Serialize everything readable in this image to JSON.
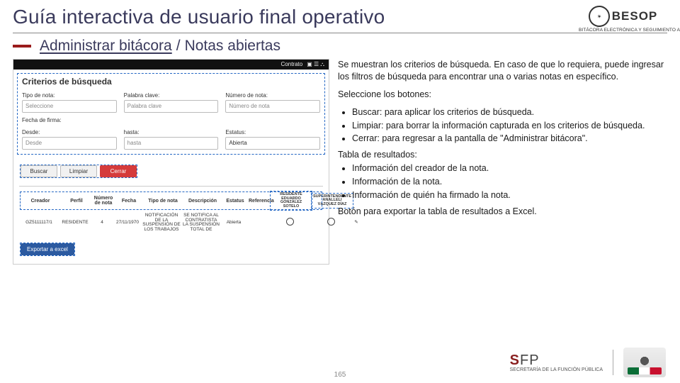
{
  "brand": {
    "name": "BESOP",
    "subtitle": "BITÁCORA ELECTRÓNICA Y SEGUIMIENTO A OBRA PÚBLICA"
  },
  "header": {
    "title": "Guía interactiva de usuario final operativo",
    "breadcrumb_main": "Administrar bitácora",
    "breadcrumb_sep": "/",
    "breadcrumb_sub": "Notas abiertas"
  },
  "mock": {
    "topbar": {
      "contrato": "Contrato",
      "icons": "▣ ☰ ⛬"
    },
    "section_title": "Criterios de búsqueda",
    "filters": {
      "tipo_nota_label": "Tipo de nota:",
      "tipo_nota_value": "Seleccione",
      "palabra_label": "Palabra clave:",
      "palabra_value": "Palabra clave",
      "numero_label": "Número de nota:",
      "numero_value": "Número de nota",
      "fecha_label": "Fecha de firma:",
      "desde_label": "Desde:",
      "desde_value": "Desde",
      "hasta_label": "hasta:",
      "hasta_value": "hasta",
      "estatus_label": "Estatus:",
      "estatus_value": "Abierta"
    },
    "buttons": {
      "buscar": "Buscar",
      "limpiar": "Limpiar",
      "cerrar": "Cerrar",
      "exportar": "Exportar a excel"
    },
    "table": {
      "headers": {
        "creador": "Creador",
        "perfil": "Perfil",
        "numero": "Número de nota",
        "fecha": "Fecha",
        "tipo": "Tipo de nota",
        "descripcion": "Descripción",
        "estatus": "Estatus",
        "referencia": "Referencia",
        "sig1": "RESIDENTE EDUARDO GONZÁLEZ SOTELO",
        "sig2": "SUPERINTENDENTE ANALLELI VÁZQUEZ DÍAZ"
      },
      "row1": {
        "creador": "GZ5111117/1",
        "perfil": "RESIDENTE",
        "numero": "4",
        "fecha": "27/11/1970",
        "tipo": "NOTIFICACIÓN DE LA SUSPENSIÓN DE LOS TRABAJOS",
        "descripcion": "SE NOTIFICA AL CONTRATISTA LA SUSPENSIÓN TOTAL DE",
        "estatus": "Abierta",
        "referencia": ""
      }
    }
  },
  "instr": {
    "p1": "Se muestran los criterios de búsqueda. En caso de que lo requiera, puede ingresar los filtros de búsqueda para encontrar una o varias notas en específico.",
    "p2": "Seleccione los botones:",
    "b1": "Buscar: para aplicar los criterios de búsqueda.",
    "b2": "Limpiar: para borrar la información capturada en los criterios de búsqueda.",
    "b3": "Cerrar: para regresar a la pantalla de \"Administrar bitácora\".",
    "p3": "Tabla de resultados:",
    "t1": "Información del creador de la nota.",
    "t2": "Información de la nota.",
    "t3": "Información de quién ha firmado la nota.",
    "p4": "Botón para exportar la tabla de resultados a Excel."
  },
  "footer": {
    "sfp_name": "SFP",
    "sfp_sub": "SECRETARÍA DE LA FUNCIÓN PÚBLICA"
  },
  "page_number": "165"
}
